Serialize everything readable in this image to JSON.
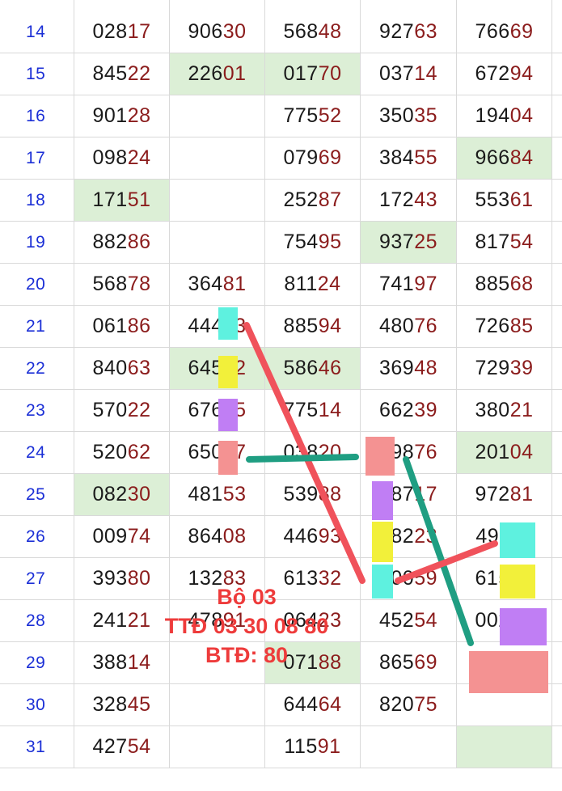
{
  "colors": {
    "day": "#1b2fd6",
    "prefix": "#1a1a1a",
    "suffix": "#8b1c1c",
    "highlight_green": "#dcefd6",
    "mark_cyan": "#5ef1df",
    "mark_yellow": "#f2f03a",
    "mark_purple": "#c07ef4",
    "mark_red": "#f49292",
    "note": "#ee3b3b",
    "line_red": "#f0525b",
    "line_teal": "#1f9e82"
  },
  "rows": [
    {
      "day": "14",
      "cells": [
        {
          "v": "02817"
        },
        {
          "v": "90630"
        },
        {
          "v": "56848"
        },
        {
          "v": "92763"
        },
        {
          "v": "76669"
        }
      ]
    },
    {
      "day": "15",
      "cells": [
        {
          "v": "84522"
        },
        {
          "v": "22601",
          "hl": true
        },
        {
          "v": "01770",
          "hl": true
        },
        {
          "v": "03714"
        },
        {
          "v": "67294"
        }
      ]
    },
    {
      "day": "16",
      "cells": [
        {
          "v": "90128"
        },
        {
          "v": ""
        },
        {
          "v": "77552"
        },
        {
          "v": "35035"
        },
        {
          "v": "19404"
        }
      ]
    },
    {
      "day": "17",
      "cells": [
        {
          "v": "09824"
        },
        {
          "v": ""
        },
        {
          "v": "07969"
        },
        {
          "v": "38455"
        },
        {
          "v": "96684",
          "hl": true
        }
      ]
    },
    {
      "day": "18",
      "cells": [
        {
          "v": "17151",
          "hl": true
        },
        {
          "v": ""
        },
        {
          "v": "25287"
        },
        {
          "v": "17243"
        },
        {
          "v": "55361"
        }
      ]
    },
    {
      "day": "19",
      "cells": [
        {
          "v": "88286"
        },
        {
          "v": ""
        },
        {
          "v": "75495"
        },
        {
          "v": "93725",
          "hl": true
        },
        {
          "v": "81754"
        }
      ]
    },
    {
      "day": "20",
      "cells": [
        {
          "v": "56878"
        },
        {
          "v": "36481"
        },
        {
          "v": "81124"
        },
        {
          "v": "74197"
        },
        {
          "v": "88568"
        }
      ]
    },
    {
      "day": "21",
      "cells": [
        {
          "v": "06186"
        },
        {
          "v": "44413"
        },
        {
          "v": "88594"
        },
        {
          "v": "48076"
        },
        {
          "v": "72685"
        }
      ]
    },
    {
      "day": "22",
      "cells": [
        {
          "v": "84063"
        },
        {
          "v": "64512",
          "hl": true
        },
        {
          "v": "58646",
          "hl": true
        },
        {
          "v": "36948"
        },
        {
          "v": "72939"
        }
      ]
    },
    {
      "day": "23",
      "cells": [
        {
          "v": "57022"
        },
        {
          "v": "67655"
        },
        {
          "v": "77514"
        },
        {
          "v": "66239"
        },
        {
          "v": "38021"
        }
      ]
    },
    {
      "day": "24",
      "cells": [
        {
          "v": "52062"
        },
        {
          "v": "65037"
        },
        {
          "v": "03820"
        },
        {
          "v": "09876"
        },
        {
          "v": "20104",
          "hl": true
        }
      ]
    },
    {
      "day": "25",
      "cells": [
        {
          "v": "08230",
          "hl": true
        },
        {
          "v": "48153"
        },
        {
          "v": "53988"
        },
        {
          "v": "08717"
        },
        {
          "v": "97281"
        }
      ]
    },
    {
      "day": "26",
      "cells": [
        {
          "v": "00974"
        },
        {
          "v": "86408"
        },
        {
          "v": "44693"
        },
        {
          "v": "38223"
        },
        {
          "v": "49111"
        }
      ]
    },
    {
      "day": "27",
      "cells": [
        {
          "v": "39380"
        },
        {
          "v": "13283"
        },
        {
          "v": "61332"
        },
        {
          "v": "10059"
        },
        {
          "v": "61513"
        }
      ]
    },
    {
      "day": "28",
      "cells": [
        {
          "v": "24121"
        },
        {
          "v": "47891"
        },
        {
          "v": "06423"
        },
        {
          "v": "45254"
        },
        {
          "v": "00250"
        }
      ]
    },
    {
      "day": "29",
      "cells": [
        {
          "v": "38814"
        },
        {
          "v": ""
        },
        {
          "v": "07188",
          "hl": true
        },
        {
          "v": "86569"
        },
        {
          "v": ""
        }
      ]
    },
    {
      "day": "30",
      "cells": [
        {
          "v": "32845"
        },
        {
          "v": ""
        },
        {
          "v": "64464"
        },
        {
          "v": "82075"
        },
        {
          "v": ""
        }
      ]
    },
    {
      "day": "31",
      "cells": [
        {
          "v": "42754"
        },
        {
          "v": ""
        },
        {
          "v": "11591"
        },
        {
          "v": ""
        },
        {
          "v": "",
          "hl": true
        }
      ]
    }
  ],
  "note": {
    "line1": "Bộ 03",
    "line2": "TTĐ 03 30 08 80",
    "line3": "BTĐ: 80"
  }
}
